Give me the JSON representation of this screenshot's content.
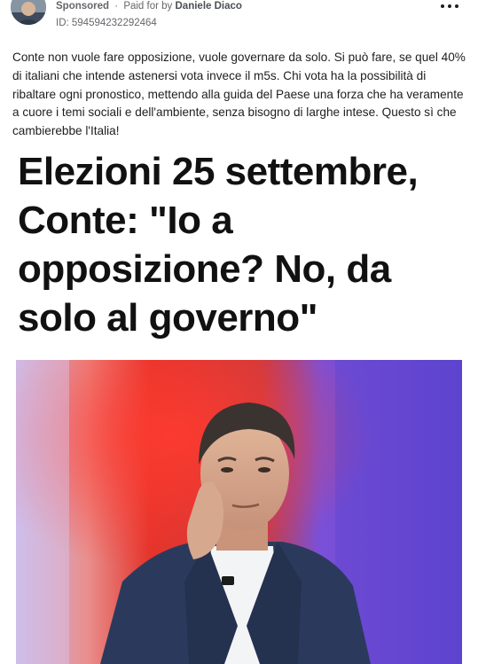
{
  "header": {
    "sponsored_label": "Sponsored",
    "separator": "·",
    "paid_for_prefix": "Paid for by",
    "payer_name": "Daniele Diaco",
    "ad_id": "ID: 594594232292464",
    "more_icon": "more-horizontal-icon"
  },
  "post": {
    "body": "Conte non vuole fare opposizione, vuole governare da solo. Si può fare, se quel 40% di italiani che intende astenersi vota invece il m5s. Chi vota ha la possibilità di ribaltare ogni pronostico, mettendo alla guida del Paese una forza che ha veramente a cuore i temi sociali e dell'ambiente, senza bisogno di larghe intese. Questo sì che cambierebbe l'Italia!"
  },
  "creative": {
    "headline_lines": [
      "Elezioni 25 settembre,",
      "Conte: \"Io a",
      "opposizione? No, da",
      "solo al governo\""
    ]
  },
  "colors": {
    "meta_text": "#65676b",
    "body_text": "#1c1e21",
    "headline_text": "#111111",
    "photo_bg_red": "#d9302a",
    "photo_bg_blue": "#6a4fd8",
    "suit": "#2b3a5c"
  }
}
